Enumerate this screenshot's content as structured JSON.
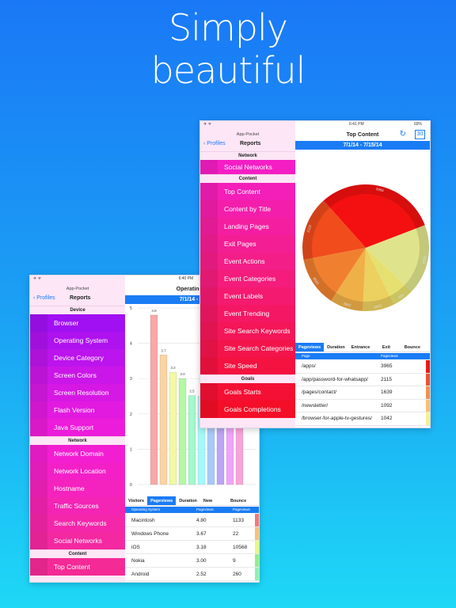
{
  "hero": {
    "line1": "Simply",
    "line2": "beautiful"
  },
  "back_device": {
    "app_title": "App-Pocket",
    "back_label": "Profiles",
    "nav_title": "Reports",
    "time": "6:40 PM",
    "page_title": "Operating S",
    "date_range": "7/1/14 - 7/",
    "sidebar": [
      {
        "type": "header",
        "label": "Device"
      },
      {
        "label": "Browser",
        "color": "#a010f2"
      },
      {
        "label": "Operating System",
        "color": "#ae12ef"
      },
      {
        "label": "Device Category",
        "color": "#bc14ec"
      },
      {
        "label": "Screen Colors",
        "color": "#ca16e8"
      },
      {
        "label": "Screen Resolution",
        "color": "#d618e4"
      },
      {
        "label": "Flash Version",
        "color": "#e21ae0"
      },
      {
        "label": "Java Support",
        "color": "#ec1cda"
      },
      {
        "type": "header",
        "label": "Network"
      },
      {
        "label": "Network Domain",
        "color": "#f21ed2"
      },
      {
        "label": "Network Location",
        "color": "#f320c8"
      },
      {
        "label": "Hostname",
        "color": "#f422be"
      },
      {
        "label": "Traffic Sources",
        "color": "#f424b4"
      },
      {
        "label": "Search Keywords",
        "color": "#f426aa"
      },
      {
        "label": "Social Networks",
        "color": "#f428a0"
      },
      {
        "type": "header",
        "label": "Content"
      },
      {
        "label": "Top Content",
        "color": "#f42a96"
      }
    ],
    "tabs": [
      {
        "label": "Visitors"
      },
      {
        "label": "Pageviews",
        "active": true
      },
      {
        "label": "Duration"
      },
      {
        "label": "New Visits"
      },
      {
        "label": "Bounce Rate"
      }
    ],
    "table": {
      "headers": [
        "Operating System",
        "Pageviews",
        "Pageviews"
      ],
      "rows": [
        [
          "Macintosh",
          "4.80",
          "1133",
          "#f47878"
        ],
        [
          "Windows Phone",
          "3.67",
          "22",
          "#f8c078"
        ],
        [
          "iOS",
          "3.18",
          "10568",
          "#e8f880"
        ],
        [
          "Nokia",
          "3.00",
          "9",
          "#90f088"
        ],
        [
          "Android",
          "2.52",
          "260",
          "#90f0b0"
        ]
      ]
    }
  },
  "chart_data": {
    "type": "bar",
    "ylim": [
      0,
      5
    ],
    "yticks": [
      "0",
      "1",
      "2",
      "3",
      "4",
      "5"
    ],
    "values": [
      4.8,
      3.67,
      3.18,
      3.0,
      2.52,
      2.5,
      2.3,
      2.2,
      2.1,
      2.0
    ],
    "labels": [
      "4.8",
      "3.7",
      "3.2",
      "3.0",
      "2.5",
      "",
      "",
      "",
      "",
      ""
    ],
    "colors": [
      "#f8a8a8",
      "#fcd4a4",
      "#f2f8a4",
      "#b4f8a4",
      "#a4f8cc",
      "#a4f8f8",
      "#a8c8f8",
      "#bca4f8",
      "#f0a4f8",
      "#f8a4d8"
    ]
  },
  "front_device": {
    "app_title": "App-Pocket",
    "back_label": "Profiles",
    "nav_title": "Reports",
    "time": "6:41 PM",
    "battery": "69%",
    "page_title": "Top Content",
    "date_range": "7/1/14 - 7/15/14",
    "calendar_day": "30",
    "sidebar": [
      {
        "type": "header",
        "label": "Network"
      },
      {
        "label": "Social Networks",
        "color": "#f41ec4"
      },
      {
        "type": "header",
        "label": "Content"
      },
      {
        "label": "Top Content",
        "color": "#f41eb8"
      },
      {
        "label": "Content by Title",
        "color": "#f41eac"
      },
      {
        "label": "Landing Pages",
        "color": "#f41ea0"
      },
      {
        "label": "Exit Pages",
        "color": "#f41e94"
      },
      {
        "label": "Event Actions",
        "color": "#f41e88"
      },
      {
        "label": "Event Categories",
        "color": "#f41c7c"
      },
      {
        "label": "Event Labels",
        "color": "#f41a70"
      },
      {
        "label": "Event Trending",
        "color": "#f41864"
      },
      {
        "label": "Site Search Keywords",
        "color": "#f41658"
      },
      {
        "label": "Site Search Categories",
        "color": "#f4144c"
      },
      {
        "label": "Site Speed",
        "color": "#f41240"
      },
      {
        "type": "header",
        "label": "Goals"
      },
      {
        "label": "Goals Starts",
        "color": "#f41034"
      },
      {
        "label": "Goals Completions",
        "color": "#f40e28"
      }
    ],
    "pie": {
      "slices": [
        {
          "value": 3965,
          "color": "#f41010"
        },
        {
          "value": 2324,
          "color": "#dfe48c"
        },
        {
          "value": 705,
          "color": "#e6e070"
        },
        {
          "value": 1042,
          "color": "#ecd060"
        },
        {
          "value": 1092,
          "color": "#efb048"
        },
        {
          "value": 1639,
          "color": "#f08030"
        },
        {
          "value": 2115,
          "color": "#f04c1c"
        }
      ]
    },
    "tabs": [
      {
        "label": "Pageviews",
        "active": true
      },
      {
        "label": "Duration"
      },
      {
        "label": "Entrance Rate"
      },
      {
        "label": "Exit Rate"
      },
      {
        "label": "Bounce Rate"
      }
    ],
    "table": {
      "headers": [
        "Page",
        "Pageviews"
      ],
      "rows": [
        [
          "/apps/",
          "3965",
          "#f01818"
        ],
        [
          "/app/password-for-whatsapp/",
          "2115",
          "#f05030"
        ],
        [
          "/pages/contact/",
          "1639",
          "#f49050"
        ],
        [
          "/newsletter/",
          "1092",
          "#f8c070"
        ],
        [
          "/browser-for-apple-tv-gestures/",
          "1042",
          "#f8f090"
        ]
      ]
    }
  }
}
